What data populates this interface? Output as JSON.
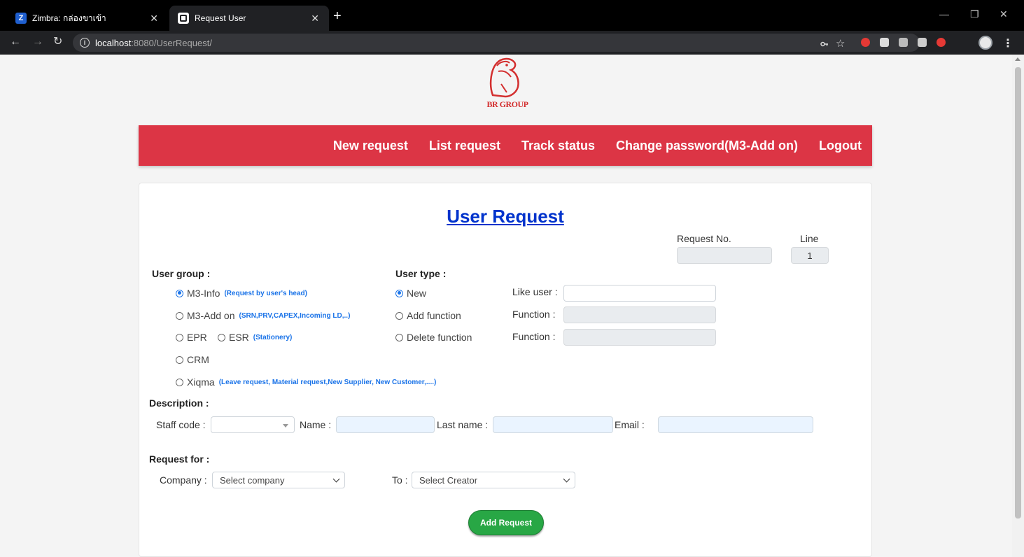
{
  "browser": {
    "tabs": [
      {
        "title": "Zimbra: กล่องขาเข้า",
        "favicon_letter": "Z"
      },
      {
        "title": "Request User"
      }
    ],
    "url_host": "localhost",
    "url_path": ":8080/UserRequest/"
  },
  "brand": {
    "name": "BR GROUP",
    "color": "#d32f2f"
  },
  "nav": {
    "color": "#dc3545",
    "items": [
      "New request",
      "List request",
      "Track status",
      "Change password(M3-Add on)",
      "Logout"
    ]
  },
  "form": {
    "title": "User Request",
    "request_no_label": "Request No.",
    "request_no_value": "",
    "line_label": "Line",
    "line_value": "1",
    "user_group": {
      "label": "User group :",
      "options": [
        {
          "label": "M3-Info",
          "hint": "(Request by user's head)",
          "checked": true
        },
        {
          "label": "M3-Add on",
          "hint": "(SRN,PRV,CAPEX,Incoming LD,..)",
          "checked": false
        },
        {
          "label": "EPR",
          "hint": "",
          "checked": false
        },
        {
          "label": "ESR",
          "hint": "(Stationery)",
          "checked": false
        },
        {
          "label": "CRM",
          "hint": "",
          "checked": false
        },
        {
          "label": "Xiqma",
          "hint": "(Leave request, Material request,New Supplier, New Customer,....)",
          "checked": false
        }
      ]
    },
    "user_type": {
      "label": "User type :",
      "options": [
        {
          "label": "New",
          "checked": true,
          "field_label": "Like user :",
          "field_value": ""
        },
        {
          "label": "Add function",
          "checked": false,
          "field_label": "Function :",
          "field_value": ""
        },
        {
          "label": "Delete function",
          "checked": false,
          "field_label": "Function :",
          "field_value": ""
        }
      ]
    },
    "description": {
      "label": "Description :",
      "staff_code_label": "Staff code :",
      "staff_code_value": "",
      "name_label": "Name :",
      "name_value": "",
      "last_name_label": "Last name :",
      "last_name_value": "",
      "email_label": "Email :",
      "email_value": ""
    },
    "request_for": {
      "label": "Request for :",
      "company_label": "Company :",
      "company_value": "Select company",
      "to_label": "To :",
      "to_value": "Select Creator"
    },
    "submit_label": "Add Request",
    "submit_color": "#28a745"
  }
}
